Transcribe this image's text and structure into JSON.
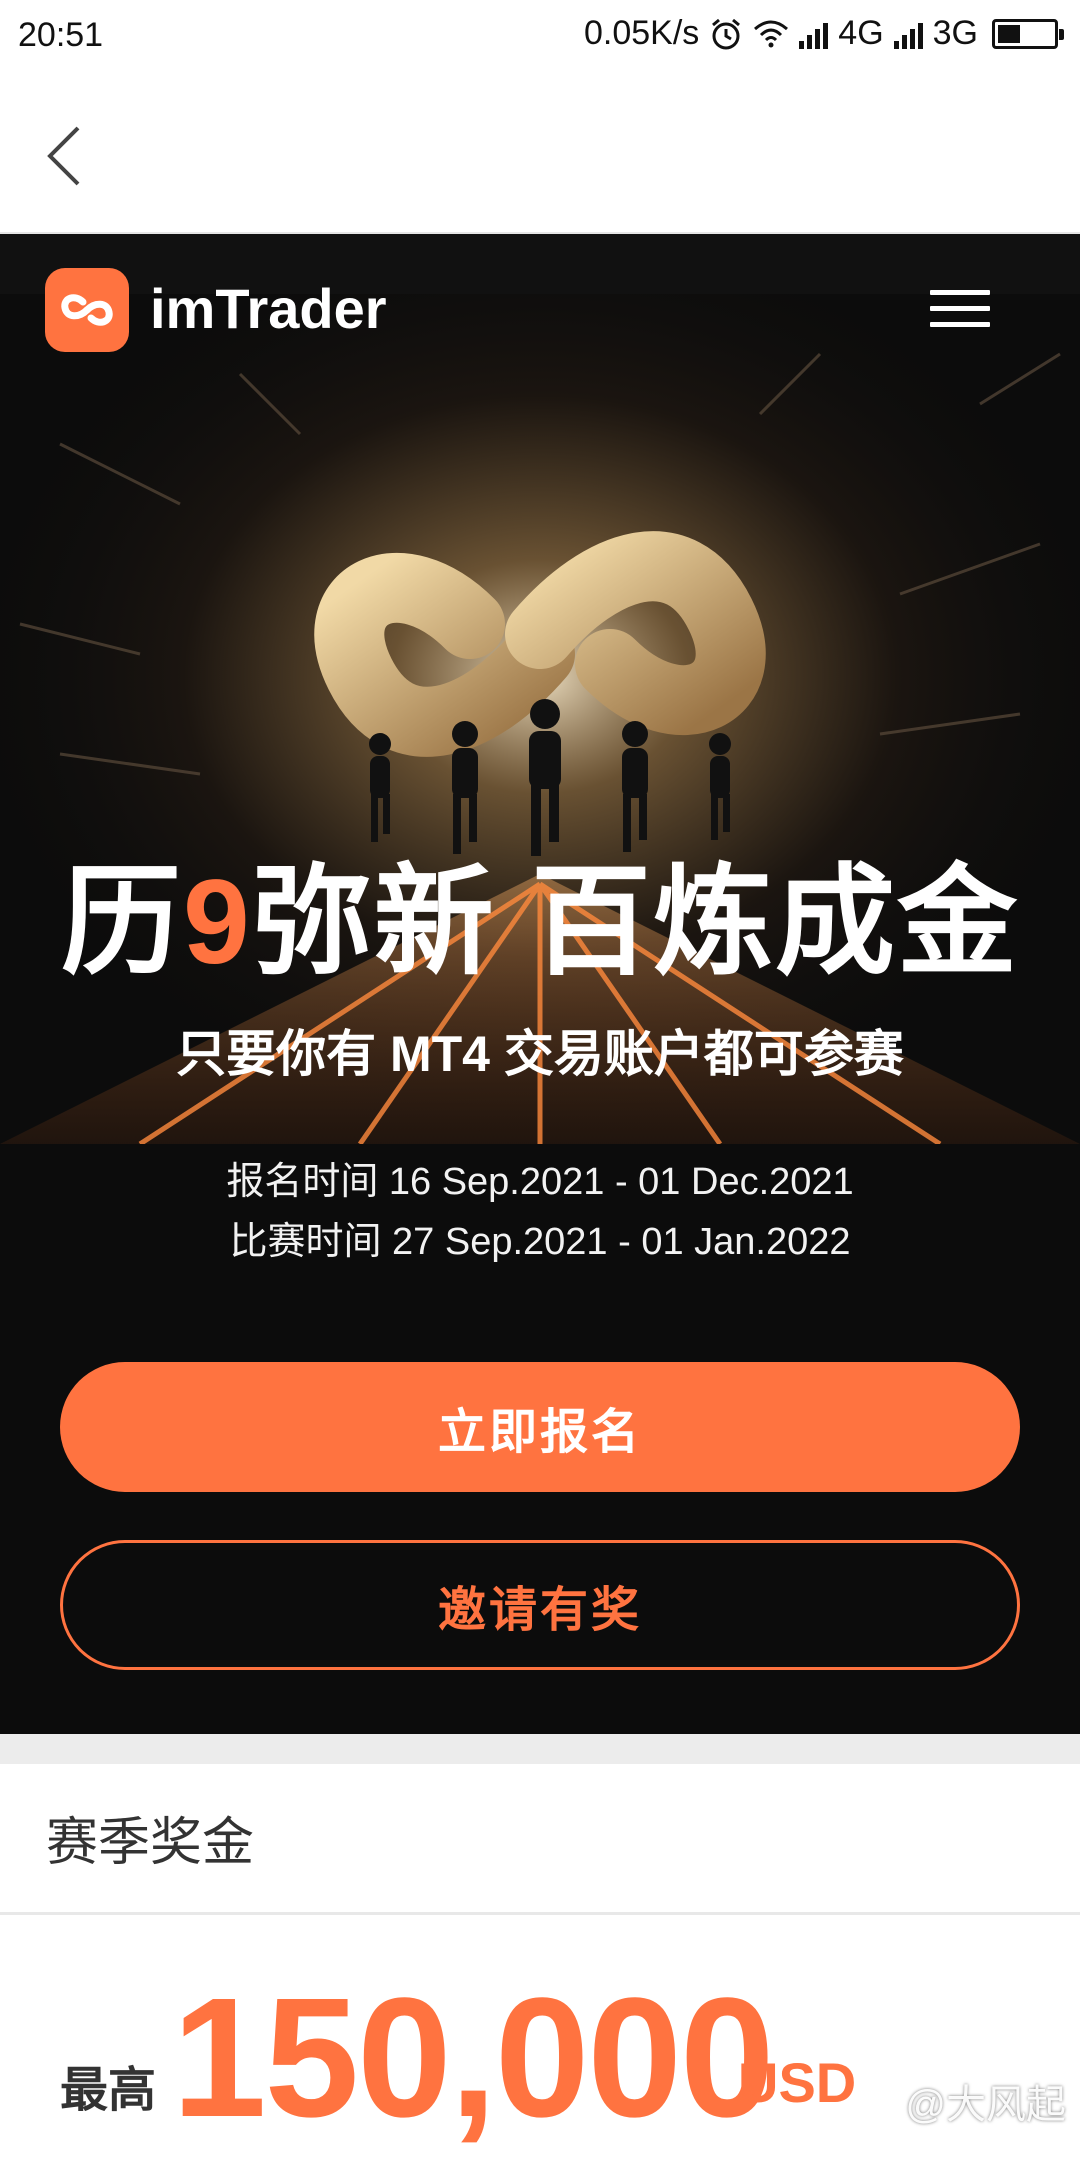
{
  "status_bar": {
    "time": "20:51",
    "speed": "0.05K/s",
    "net1": "4G",
    "net2": "3G"
  },
  "hero": {
    "brand": "imTrader",
    "headline_a": "历",
    "headline_num": "9",
    "headline_b": "弥新 百炼成金",
    "subtitle": "只要你有 MT4 交易账户都可参赛",
    "signup_time": "报名时间 16 Sep.2021 - 01 Dec.2021",
    "match_time": "比赛时间 27 Sep.2021 - 01 Jan.2022",
    "primary_button": "立即报名",
    "secondary_button": "邀请有奖"
  },
  "prize": {
    "section_title": "赛季奖金",
    "label": "最高",
    "amount": "150,000",
    "unit": "USD"
  },
  "watermark": "@大风起",
  "colors": {
    "accent": "#ff7340",
    "dark": "#0c0c0c"
  },
  "icons": [
    "back-icon",
    "menu-icon",
    "logo-icon",
    "alarm-icon",
    "wifi-icon",
    "signal-icon",
    "battery-icon"
  ]
}
